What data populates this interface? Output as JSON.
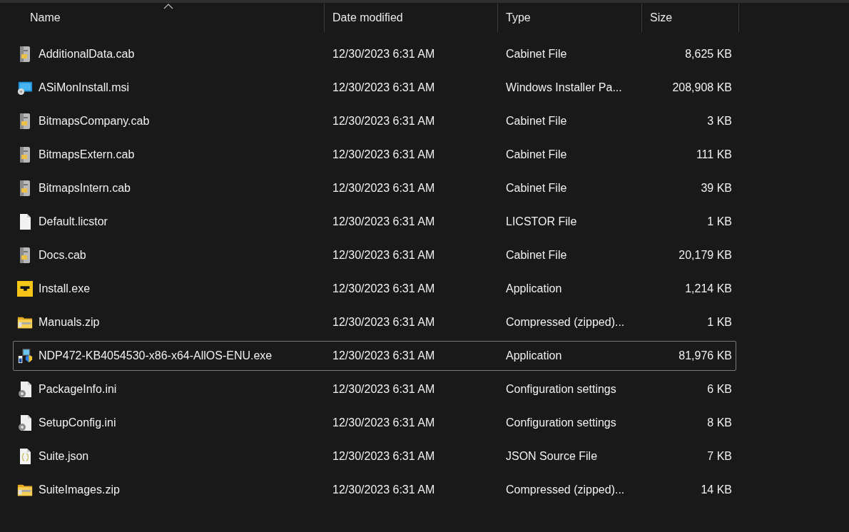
{
  "columns": [
    {
      "label": "Name",
      "sorted": true
    },
    {
      "label": "Date modified",
      "sorted": false
    },
    {
      "label": "Type",
      "sorted": false
    },
    {
      "label": "Size",
      "sorted": false
    }
  ],
  "rows": [
    {
      "kind": "cabinet",
      "name": "AdditionalData.cab",
      "date": "12/30/2023 6:31 AM",
      "type": "Cabinet File",
      "size": "8,625 KB",
      "selected": false
    },
    {
      "kind": "installer",
      "name": "ASiMonInstall.msi",
      "date": "12/30/2023 6:31 AM",
      "type": "Windows Installer Pa...",
      "size": "208,908 KB",
      "selected": false
    },
    {
      "kind": "cabinet",
      "name": "BitmapsCompany.cab",
      "date": "12/30/2023 6:31 AM",
      "type": "Cabinet File",
      "size": "3 KB",
      "selected": false
    },
    {
      "kind": "cabinet",
      "name": "BitmapsExtern.cab",
      "date": "12/30/2023 6:31 AM",
      "type": "Cabinet File",
      "size": "111 KB",
      "selected": false
    },
    {
      "kind": "cabinet",
      "name": "BitmapsIntern.cab",
      "date": "12/30/2023 6:31 AM",
      "type": "Cabinet File",
      "size": "39 KB",
      "selected": false
    },
    {
      "kind": "blank",
      "name": "Default.licstor",
      "date": "12/30/2023 6:31 AM",
      "type": "LICSTOR File",
      "size": "1 KB",
      "selected": false
    },
    {
      "kind": "cabinet",
      "name": "Docs.cab",
      "date": "12/30/2023 6:31 AM",
      "type": "Cabinet File",
      "size": "20,179 KB",
      "selected": false
    },
    {
      "kind": "app",
      "name": "Install.exe",
      "date": "12/30/2023 6:31 AM",
      "type": "Application",
      "size": "1,214 KB",
      "selected": false
    },
    {
      "kind": "zip",
      "name": "Manuals.zip",
      "date": "12/30/2023 6:31 AM",
      "type": "Compressed (zipped)...",
      "size": "1 KB",
      "selected": false
    },
    {
      "kind": "setup",
      "name": "NDP472-KB4054530-x86-x64-AllOS-ENU.exe",
      "date": "12/30/2023 6:31 AM",
      "type": "Application",
      "size": "81,976 KB",
      "selected": true
    },
    {
      "kind": "ini",
      "name": "PackageInfo.ini",
      "date": "12/30/2023 6:31 AM",
      "type": "Configuration settings",
      "size": "6 KB",
      "selected": false
    },
    {
      "kind": "ini",
      "name": "SetupConfig.ini",
      "date": "12/30/2023 6:31 AM",
      "type": "Configuration settings",
      "size": "8 KB",
      "selected": false
    },
    {
      "kind": "json",
      "name": "Suite.json",
      "date": "12/30/2023 6:31 AM",
      "type": "JSON Source File",
      "size": "7 KB",
      "selected": false
    },
    {
      "kind": "zip",
      "name": "SuiteImages.zip",
      "date": "12/30/2023 6:31 AM",
      "type": "Compressed (zipped)...",
      "size": "14 KB",
      "selected": false
    }
  ]
}
